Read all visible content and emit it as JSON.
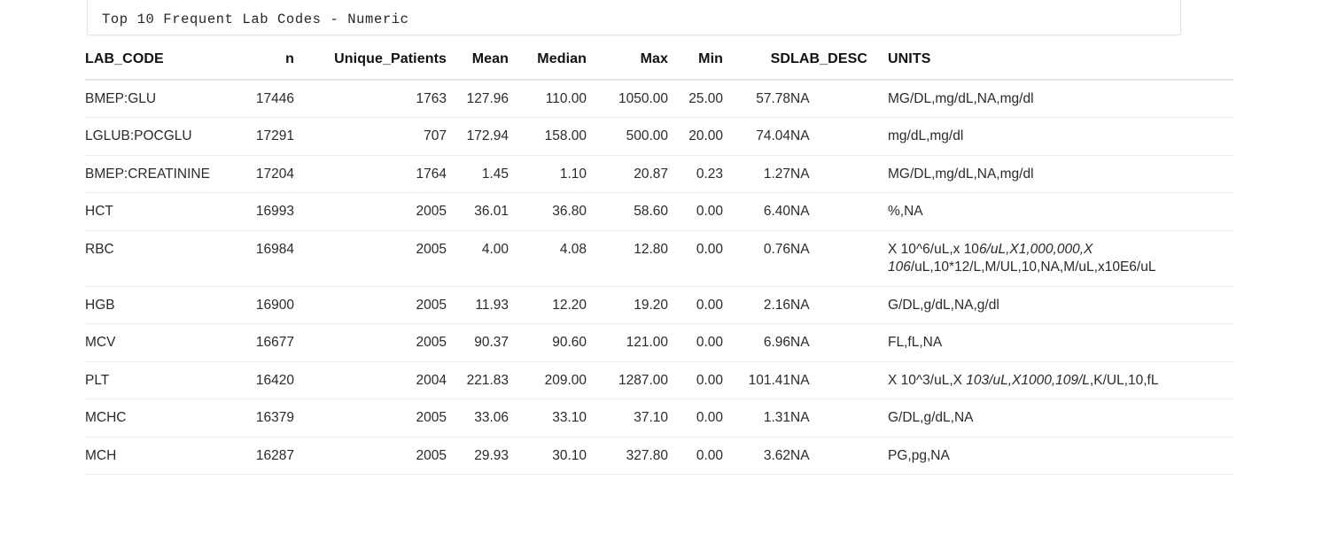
{
  "title": {
    "text": "Top 10 Frequent Lab Codes - Numeric"
  },
  "table": {
    "columns": [
      {
        "key": "lab_code",
        "label": "LAB_CODE"
      },
      {
        "key": "n",
        "label": "n"
      },
      {
        "key": "unique_patients",
        "label": "Unique_Patients"
      },
      {
        "key": "mean",
        "label": "Mean"
      },
      {
        "key": "median",
        "label": "Median"
      },
      {
        "key": "max",
        "label": "Max"
      },
      {
        "key": "min",
        "label": "Min"
      },
      {
        "key": "sd",
        "label": "SD"
      },
      {
        "key": "lab_desc",
        "label": "LAB_DESC"
      },
      {
        "key": "units",
        "label": "UNITS"
      }
    ],
    "rows": [
      {
        "lab_code": "BMEP:GLU",
        "n": "17446",
        "unique_patients": "1763",
        "mean": "127.96",
        "median": "110.00",
        "max": "1050.00",
        "min": "25.00",
        "sd": "57.78",
        "lab_desc": "NA",
        "units": "MG/DL,mg/dL,NA,mg/dl"
      },
      {
        "lab_code": "LGLUB:POCGLU",
        "n": "17291",
        "unique_patients": "707",
        "mean": "172.94",
        "median": "158.00",
        "max": "500.00",
        "min": "20.00",
        "sd": "74.04",
        "lab_desc": "NA",
        "units": "mg/dL,mg/dl"
      },
      {
        "lab_code": "BMEP:CREATININE",
        "n": "17204",
        "unique_patients": "1764",
        "mean": "1.45",
        "median": "1.10",
        "max": "20.87",
        "min": "0.23",
        "sd": "1.27",
        "lab_desc": "NA",
        "units": "MG/DL,mg/dL,NA,mg/dl"
      },
      {
        "lab_code": "HCT",
        "n": "16993",
        "unique_patients": "2005",
        "mean": "36.01",
        "median": "36.80",
        "max": "58.60",
        "min": "0.00",
        "sd": "6.40",
        "lab_desc": "NA",
        "units": "%,NA"
      },
      {
        "lab_code": "RBC",
        "n": "16984",
        "unique_patients": "2005",
        "mean": "4.00",
        "median": "4.08",
        "max": "12.80",
        "min": "0.00",
        "sd": "0.76",
        "lab_desc": "NA",
        "units": "X 10^6/uL,x 106/uL,X1,000,000,X 106/uL,10*12/L,M/UL,10,NA,M/uL,x10E6/uL",
        "units_runs": [
          {
            "t": "X 10^6/uL,x 10",
            "i": false
          },
          {
            "t": "6/uL,X1,000,000,X 106",
            "i": true
          },
          {
            "t": "/uL,10*12/L,M/UL,10,NA,M/uL,x10E6/uL",
            "i": false
          }
        ]
      },
      {
        "lab_code": "HGB",
        "n": "16900",
        "unique_patients": "2005",
        "mean": "11.93",
        "median": "12.20",
        "max": "19.20",
        "min": "0.00",
        "sd": "2.16",
        "lab_desc": "NA",
        "units": "G/DL,g/dL,NA,g/dl"
      },
      {
        "lab_code": "MCV",
        "n": "16677",
        "unique_patients": "2005",
        "mean": "90.37",
        "median": "90.60",
        "max": "121.00",
        "min": "0.00",
        "sd": "6.96",
        "lab_desc": "NA",
        "units": "FL,fL,NA"
      },
      {
        "lab_code": "PLT",
        "n": "16420",
        "unique_patients": "2004",
        "mean": "221.83",
        "median": "209.00",
        "max": "1287.00",
        "min": "0.00",
        "sd": "101.41",
        "lab_desc": "NA",
        "units": "X 10^3/uL,X 103/uL,X1000,109/L,K/UL,10,fL",
        "units_runs": [
          {
            "t": "X 10^3/uL,X ",
            "i": false
          },
          {
            "t": "103/uL,X1000,109/L",
            "i": true
          },
          {
            "t": ",K/UL,10,fL",
            "i": false
          }
        ]
      },
      {
        "lab_code": "MCHC",
        "n": "16379",
        "unique_patients": "2005",
        "mean": "33.06",
        "median": "33.10",
        "max": "37.10",
        "min": "0.00",
        "sd": "1.31",
        "lab_desc": "NA",
        "units": "G/DL,g/dL,NA"
      },
      {
        "lab_code": "MCH",
        "n": "16287",
        "unique_patients": "2005",
        "mean": "29.93",
        "median": "30.10",
        "max": "327.80",
        "min": "0.00",
        "sd": "3.62",
        "lab_desc": "NA",
        "units": "PG,pg,NA"
      }
    ]
  }
}
